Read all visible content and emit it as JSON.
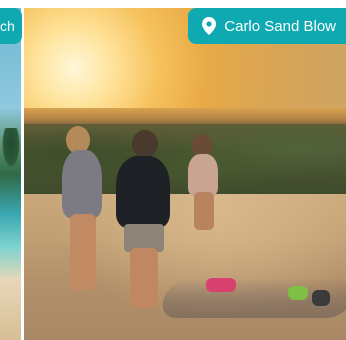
{
  "left_slide": {
    "location_label": "Beach",
    "visible_fragment": "ch"
  },
  "main_slide": {
    "location_label": "Carlo Sand Blow",
    "pin_icon": "map-pin-icon"
  },
  "colors": {
    "tag_background": "#0fa9b2",
    "tag_text": "#ffffff"
  }
}
